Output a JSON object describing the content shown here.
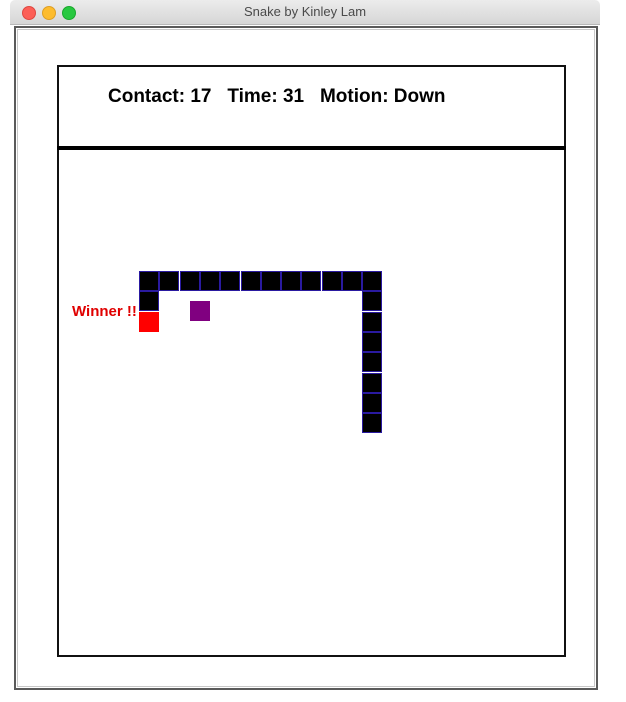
{
  "window": {
    "title": "Snake by Kinley Lam"
  },
  "status": {
    "contact_label": "Contact:",
    "contact_value": "17",
    "time_label": "Time:",
    "time_value": "31",
    "motion_label": "Motion:",
    "motion_value": "Down"
  },
  "game": {
    "winner_text": "Winner !!",
    "grid_cell_px": "board grid units",
    "snake_segments": [
      [
        0,
        0
      ],
      [
        1,
        0
      ],
      [
        2,
        0
      ],
      [
        3,
        0
      ],
      [
        4,
        0
      ],
      [
        5,
        0
      ],
      [
        6,
        0
      ],
      [
        7,
        0
      ],
      [
        8,
        0
      ],
      [
        9,
        0
      ],
      [
        10,
        0
      ],
      [
        11,
        0
      ],
      [
        0,
        1
      ],
      [
        11,
        1
      ],
      [
        11,
        2
      ],
      [
        11,
        3
      ],
      [
        11,
        4
      ],
      [
        11,
        5
      ],
      [
        11,
        6
      ],
      [
        11,
        7
      ]
    ],
    "snake_head": [
      0,
      2
    ],
    "food": [
      2.5,
      1.5
    ],
    "colors": {
      "snake_fill": "#000000",
      "snake_border": "#2a1aa0",
      "head": "#ff0000",
      "food": "#800080",
      "winner": "#e00000"
    }
  }
}
